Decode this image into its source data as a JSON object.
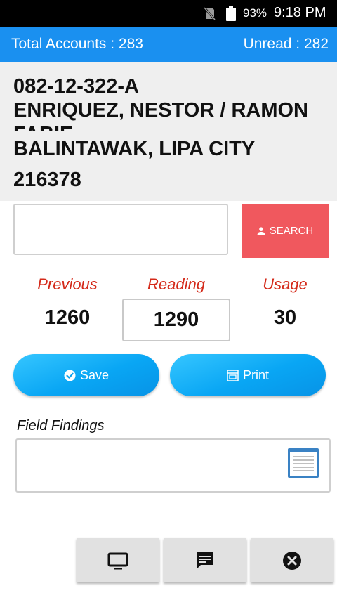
{
  "status_bar": {
    "battery": "93%",
    "time": "9:18 PM"
  },
  "header": {
    "total_accounts": "Total Accounts : 283",
    "unread": "Unread : 282"
  },
  "account": {
    "number": "082-12-322-A",
    "name": "ENRIQUEZ, NESTOR / RAMON FABIE",
    "address": "BALINTAWAK, LIPA CITY",
    "meter": "216378"
  },
  "search": {
    "value": "",
    "button_label": "SEARCH"
  },
  "reading": {
    "previous_label": "Previous",
    "reading_label": "Reading",
    "usage_label": "Usage",
    "previous_value": "1260",
    "reading_value": "1290",
    "usage_value": "30"
  },
  "actions": {
    "save_label": "Save",
    "print_label": "Print"
  },
  "field_findings": {
    "label": "Field Findings",
    "value": ""
  },
  "bottom_nav": {
    "icons": [
      "monitor-icon",
      "chat-icon",
      "close-circle-icon"
    ]
  },
  "colors": {
    "header_blue": "#1a90f0",
    "search_red": "#f0585e",
    "label_red": "#d42a1a",
    "button_blue": "#09a6f4"
  }
}
